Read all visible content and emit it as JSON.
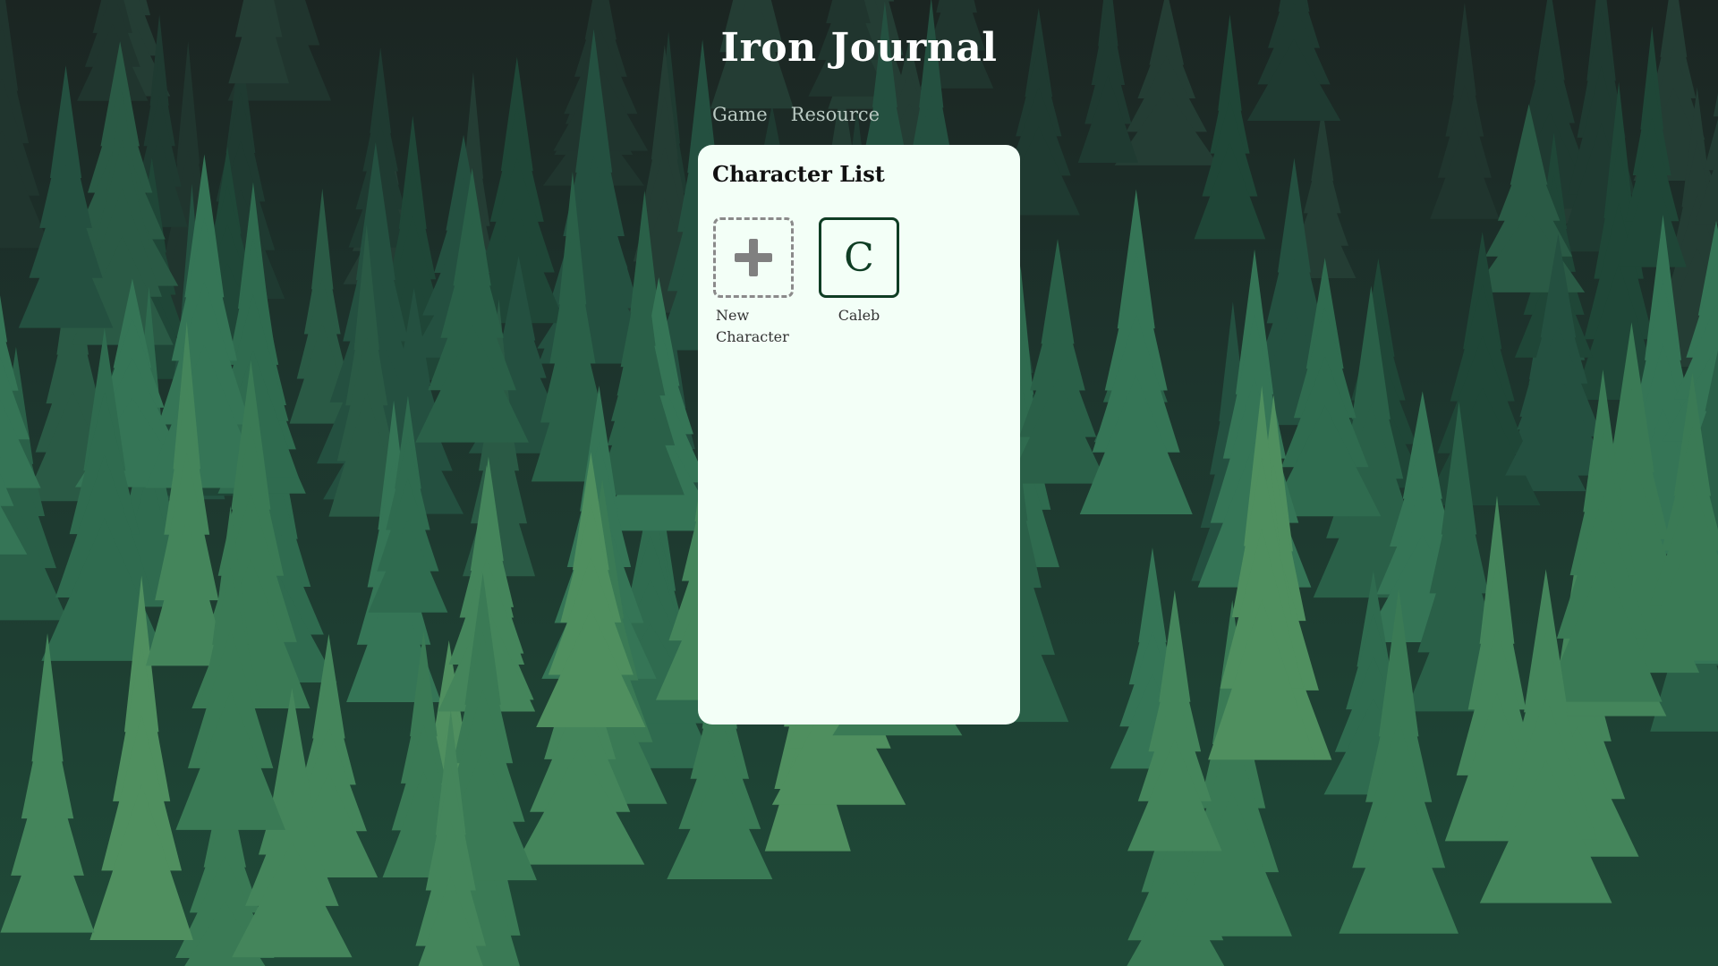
{
  "header": {
    "title": "Iron Journal"
  },
  "nav": {
    "items": [
      "Game",
      "Resource"
    ]
  },
  "panel": {
    "title": "Character List",
    "new_character_label": "New Character",
    "characters": [
      {
        "initial": "C",
        "name": "Caleb"
      }
    ]
  },
  "colors": {
    "panel_background": "#f3fff7",
    "accent_dark_green": "#0f3d24",
    "nav_text": "#b9c9c2",
    "dashed_border": "#8a8a8a"
  },
  "icons": {
    "new_character": "plus-icon",
    "background": "forest-background"
  }
}
